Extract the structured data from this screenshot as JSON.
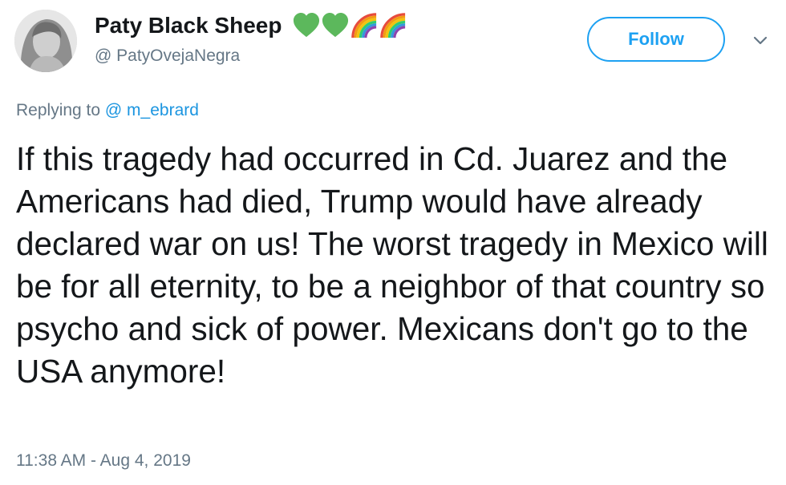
{
  "tweet": {
    "author": {
      "display_name": "Paty Black Sheep",
      "handle": "@ PatyOvejaNegra",
      "emojis": [
        "green-heart",
        "green-heart",
        "rainbow",
        "rainbow"
      ]
    },
    "follow_label": "Follow",
    "replying_prefix": "Replying to",
    "replying_mention": "@ m_ebrard",
    "text": "If this tragedy had occurred in Cd. Juarez and the Americans had died, Trump would have already declared war on us! The worst tragedy in Mexico will be for all eternity, to be a neighbor of that country so psycho and sick of power. Mexicans don't go to the USA anymore!",
    "timestamp": "11:38 AM - Aug 4, 2019"
  },
  "colors": {
    "accent": "#1da1f2",
    "mention": "#1b95e0",
    "secondary_text": "#657786",
    "primary_text": "#14171a",
    "heart_green": "#5cb85c"
  }
}
